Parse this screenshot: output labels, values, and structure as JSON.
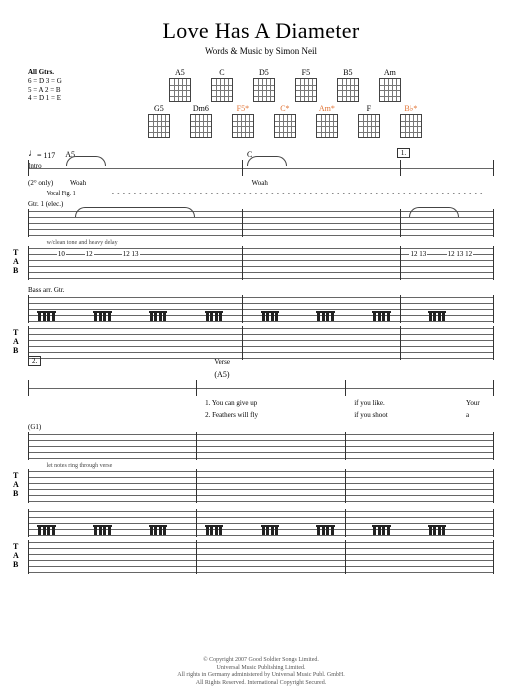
{
  "header": {
    "title": "Love Has A Diameter",
    "byline": "Words & Music by Simon Neil"
  },
  "tuning": {
    "title": "All Gtrs.",
    "lines": [
      "6 = D   3 = G",
      "5 = A   2 = B",
      "4 = D   1 = E"
    ]
  },
  "chord_row1": [
    {
      "name": "A5",
      "cls": ""
    },
    {
      "name": "C",
      "cls": ""
    },
    {
      "name": "D5",
      "cls": ""
    },
    {
      "name": "F5",
      "cls": ""
    },
    {
      "name": "B5",
      "cls": ""
    },
    {
      "name": "Am",
      "cls": ""
    }
  ],
  "chord_row2": [
    {
      "name": "G5",
      "cls": ""
    },
    {
      "name": "Dm6",
      "cls": ""
    },
    {
      "name": "F5*",
      "cls": "orange"
    },
    {
      "name": "C*",
      "cls": "orange"
    },
    {
      "name": "Am*",
      "cls": "orange"
    },
    {
      "name": "F",
      "cls": ""
    },
    {
      "name": "B♭*",
      "cls": "orange"
    }
  ],
  "tempo": {
    "bpm": "117",
    "label": "= 117"
  },
  "section_intro": "Intro",
  "section_verse": "Verse",
  "marks": {
    "a5": "A5",
    "c": "C",
    "first": "1.",
    "second": "2.",
    "a5paren": "(A5)"
  },
  "vocal": {
    "woah1": "Woah",
    "woah2": "Woah",
    "annot": "(2° only)",
    "figlabel": "Vocal Fig. 1"
  },
  "gtr_labels": {
    "g1": "Gtr. 1 (elec.)",
    "tone": "w/clean tone and heavy delay",
    "bass": "Bass arr. Gtr.",
    "g1cont": "(G1)",
    "ring": "let notes ring through verse"
  },
  "tab": {
    "t": "T",
    "a": "A",
    "b": "B"
  },
  "tabnums": {
    "n10": "10",
    "n12": "12",
    "n13": "13",
    "seqA": "12 13",
    "seqB": "12 13 12"
  },
  "lyrics": {
    "l1a": "1. You can give up",
    "l1b": "if you like.",
    "l1c": "Your",
    "l2a": "2. Feathers will fly",
    "l2b": "if you shoot",
    "l2c": "a"
  },
  "tie_dash": "- - - - - - - - - - - - - - - - - - - - - - - - - - - - - - - - - - - - - - - - - - - - - - - - - - - - - - - - - - - - - - - - - - - - - - - - - - - - - - - - - - - -",
  "footer": {
    "l1": "© Copyright 2007 Good Soldier Songs Limited.",
    "l2": "Universal Music Publishing Limited.",
    "l3": "All rights in Germany administered by Universal Music Publ. GmbH.",
    "l4": "All Rights Reserved. International Copyright Secured."
  }
}
